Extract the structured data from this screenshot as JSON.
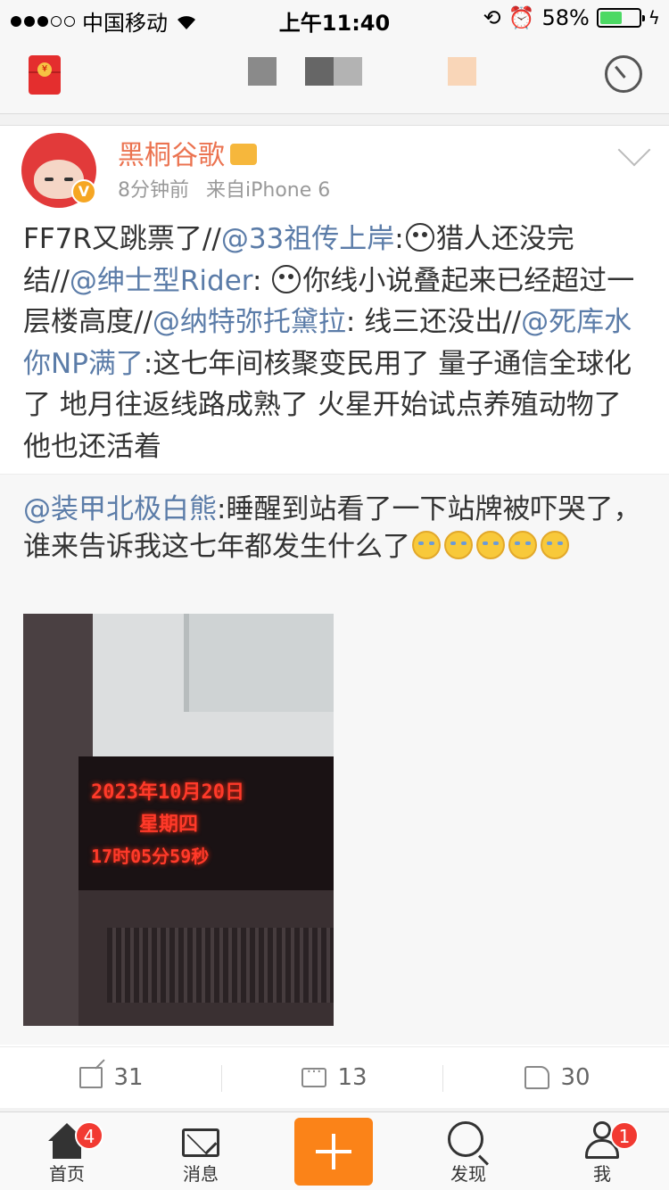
{
  "status_bar": {
    "carrier": "中国移动",
    "time": "上午11:40",
    "battery_percent": "58%",
    "battery_level": 0.58
  },
  "post": {
    "username": "黑桐谷歌",
    "time_ago": "8分钟前",
    "source": "来自iPhone 6",
    "segments": [
      {
        "t": "FF7R又跳票了//",
        "k": "text"
      },
      {
        "t": "@33祖传上岸",
        "k": "link"
      },
      {
        "t": ":",
        "k": "text"
      },
      {
        "t": "",
        "k": "emoji"
      },
      {
        "t": "猎人还没完结//",
        "k": "text"
      },
      {
        "t": "@绅士型Rider",
        "k": "link"
      },
      {
        "t": ": ",
        "k": "text"
      },
      {
        "t": "",
        "k": "emoji"
      },
      {
        "t": "你线小说叠起来已经超过一层楼高度//",
        "k": "text"
      },
      {
        "t": "@纳特弥托黛拉",
        "k": "link"
      },
      {
        "t": ": 线三还没出//",
        "k": "text"
      },
      {
        "t": "@死库水你NP满了",
        "k": "link"
      },
      {
        "t": ":这七年间核聚变民用了 量子通信全球化了 地月往返线路成熟了 火星开始试点养殖动物了 他也还活着",
        "k": "text"
      }
    ]
  },
  "repost": {
    "author": "@装甲北极白熊",
    "text": ":睡醒到站看了一下站牌被吓哭了，谁来告诉我这七年都发生什么了",
    "emoji_count": 5,
    "photo": {
      "date": "2023年10月20日",
      "weekday": "星期四",
      "clock": "17时05分59秒"
    }
  },
  "actions": {
    "reposts": "31",
    "comments": "13",
    "likes": "30"
  },
  "tabbar": {
    "home": "首页",
    "home_badge": "4",
    "messages": "消息",
    "discover": "发现",
    "me": "我",
    "me_badge": "1"
  },
  "colors": {
    "username": "#eb7350",
    "link": "#5b7ca8",
    "compose": "#fb8318",
    "badge": "#f23a32"
  }
}
